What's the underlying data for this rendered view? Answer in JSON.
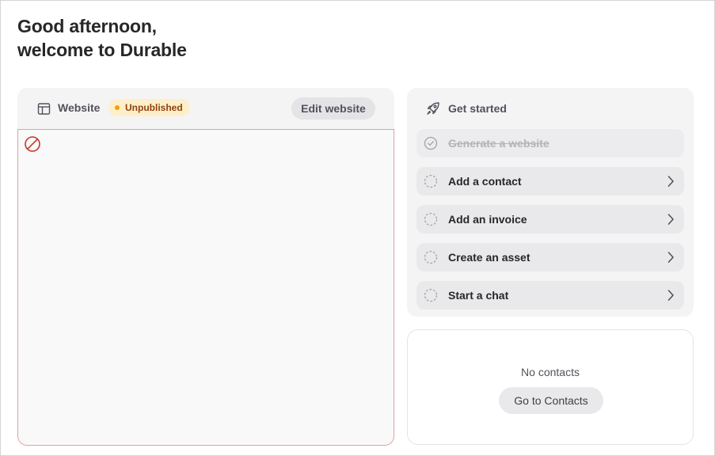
{
  "greeting": {
    "line1": "Good afternoon,",
    "line2": "welcome to Durable"
  },
  "website": {
    "title": "Website",
    "status_badge": "Unpublished",
    "edit_label": "Edit website",
    "icon": "layout-icon",
    "preview_icon": "blocked-icon"
  },
  "get_started": {
    "title": "Get started",
    "icon": "rocket-icon",
    "tasks": [
      {
        "label": "Generate a website",
        "done": true
      },
      {
        "label": "Add a contact",
        "done": false
      },
      {
        "label": "Add an invoice",
        "done": false
      },
      {
        "label": "Create an asset",
        "done": false
      },
      {
        "label": "Start a chat",
        "done": false
      }
    ]
  },
  "contacts": {
    "empty_text": "No contacts",
    "button_label": "Go to Contacts"
  },
  "colors": {
    "badge_bg": "#fdefc9",
    "badge_text": "#92400e",
    "badge_dot": "#f59e0b",
    "blocked": "#c0392b"
  }
}
